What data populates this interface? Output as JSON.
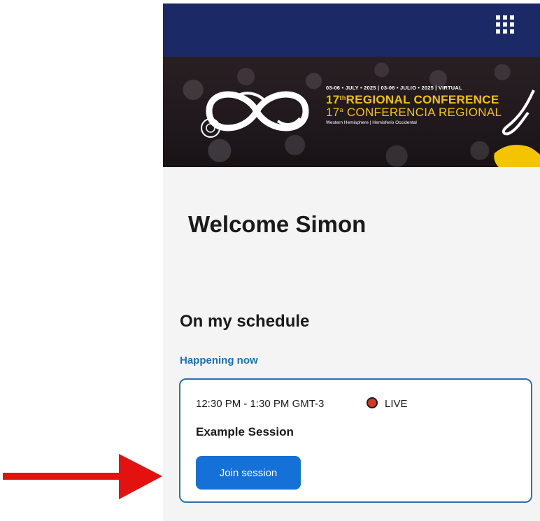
{
  "topbar": {
    "menu_icon": "apps-grid-icon",
    "background_color": "#1b2a67"
  },
  "banner": {
    "dates_line": "03-06 • JULY • 2025 | 03-06 • JULIO • 2025 | VIRTUAL",
    "title_en_number": "17",
    "title_en_suffix": "th",
    "title_en_text": "REGIONAL CONFERENCE",
    "title_es_number": "17",
    "title_es_suffix": "a",
    "title_es_text": "CONFERENCIA REGIONAL",
    "subtitle": "Western Hemisphere | Hemisferio Occidental",
    "accent_color": "#f5c400"
  },
  "welcome": {
    "text": "Welcome Simon"
  },
  "schedule": {
    "title": "On my schedule",
    "happening_label": "Happening now",
    "session": {
      "time": "12:30 PM - 1:30 PM GMT-3",
      "live_label": "LIVE",
      "live_color": "#d8381f",
      "title": "Example Session",
      "join_label": "Join session",
      "join_color": "#1570d8"
    }
  },
  "annotation": {
    "arrow_color": "#e3110f"
  }
}
